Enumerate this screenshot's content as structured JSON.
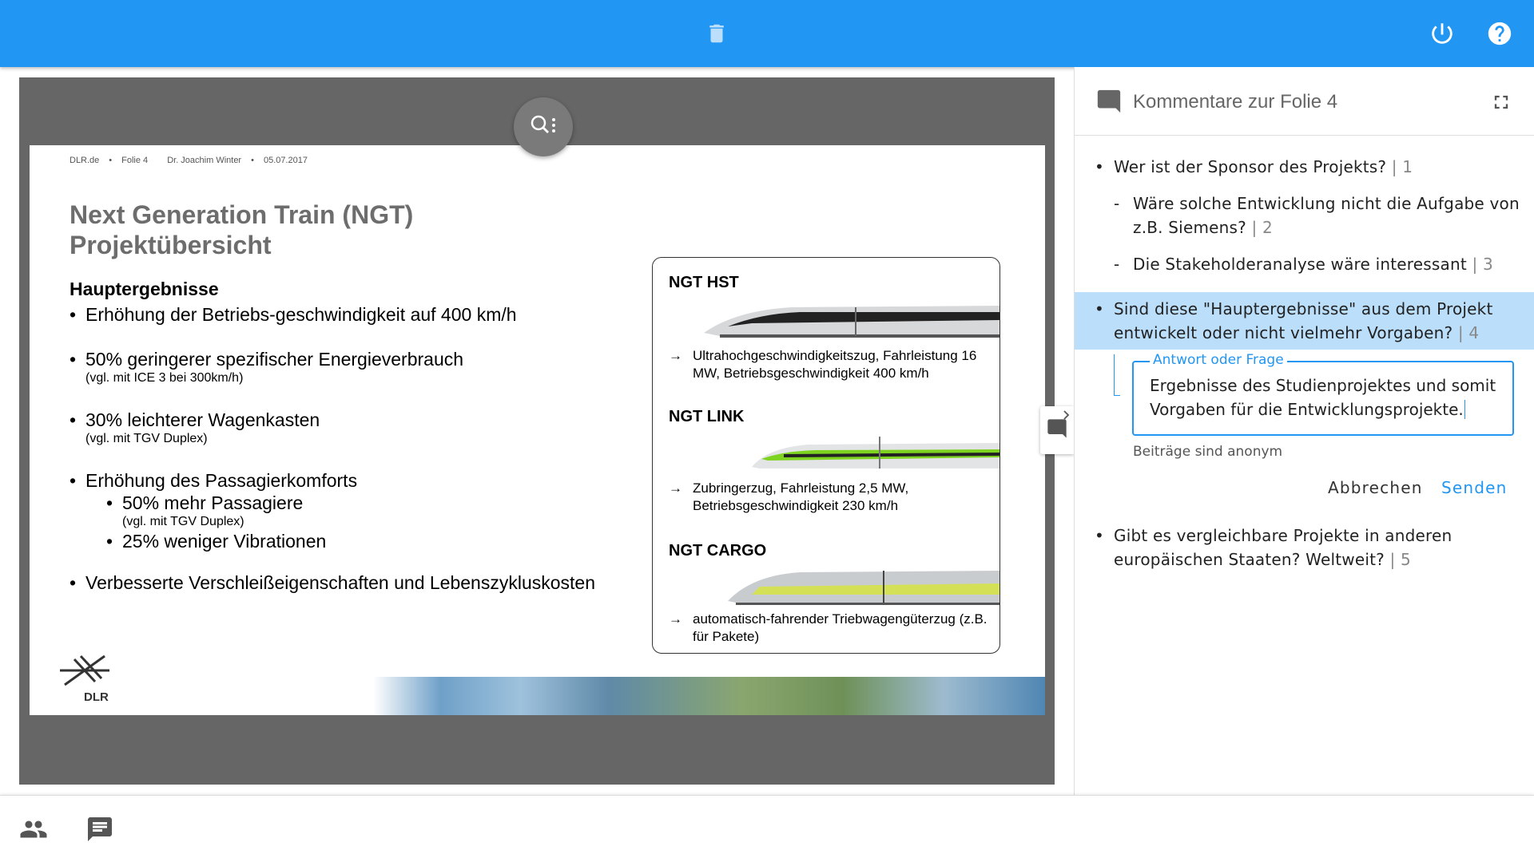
{
  "topbar": {
    "icons": [
      "trash-icon",
      "power-icon",
      "help-icon"
    ],
    "color": "#2196f3"
  },
  "stage": {
    "zoom_icon": "search-more-icon"
  },
  "slide": {
    "meta": [
      "DLR.de",
      "•",
      "Folie 4",
      "Dr. Joachim Winter",
      "•",
      "05.07.2017"
    ],
    "title_line1": "Next Generation Train (NGT)",
    "title_line2": "Projektübersicht",
    "results_heading": "Hauptergebnisse",
    "b1": "Erhöhung der Betriebs-geschwindigkeit auf 400 km/h",
    "b2": "50% geringerer spezifischer Energieverbrauch",
    "b2_sub": "(vgl. mit ICE 3 bei 300km/h)",
    "b3": "30% leichterer Wagenkasten",
    "b3_sub": "(vgl. mit TGV Duplex)",
    "b4": "Erhöhung des Passagierkomforts",
    "b4_1": "50% mehr Passagiere",
    "b4_1_sub": "(vgl. mit TGV Duplex)",
    "b4_2": "25% weniger Vibrationen",
    "b5": "Verbesserte Verschleißeigenschaften und Lebenszykluskosten",
    "trains": [
      {
        "name": "NGT HST",
        "desc_arrow": "→",
        "desc": "Ultrahochgeschwindigkeitszug, Fahrleistung 16 MW, Betriebsgeschwindigkeit 400 km/h"
      },
      {
        "name": "NGT LINK",
        "desc_arrow": "→",
        "desc": "Zubringerzug, Fahrleistung 2,5 MW, Betriebsgeschwindigkeit 230 km/h"
      },
      {
        "name": "NGT CARGO",
        "desc_arrow": "→",
        "desc": "automatisch-fahrender Triebwagengüterzug (z.B. für Pakete)"
      }
    ],
    "logo_text": "DLR"
  },
  "panel": {
    "title": "Kommentare zur Folie 4",
    "comments": [
      {
        "mark": "•",
        "text": "Wer ist der Sponsor des Projekts?",
        "num": "| 1"
      },
      {
        "mark": "-",
        "line1": "Wäre solche Entwicklung nicht die Aufgabe von",
        "line2": "z.B. Siemens?",
        "num": "| 2"
      },
      {
        "mark": "-",
        "text": "Die Stakeholderanalyse wäre interessant",
        "num": "| 3"
      },
      {
        "mark": "•",
        "line1": "Sind diese \"Hauptergebnisse\" aus dem Projekt",
        "line2": "entwickelt oder nicht vielmehr Vorgaben?",
        "num": "| 4"
      },
      {
        "mark": "•",
        "line1": "Gibt es vergleichbare Projekte in anderen",
        "line2": "europäischen Staaten? Weltweit?",
        "num": "| 5"
      }
    ],
    "answer": {
      "label": "Antwort oder Frage",
      "line1": "Ergebnisse des Studienprojektes und somit",
      "line2": "Vorgaben für die Entwicklungsprojekte.",
      "hint": "Beiträge sind anonym",
      "cancel": "Abbrechen",
      "send": "Senden"
    },
    "highlight_color": "#bbdefb"
  },
  "bottombar": {
    "icons": [
      "people-icon",
      "comment-icon"
    ]
  }
}
